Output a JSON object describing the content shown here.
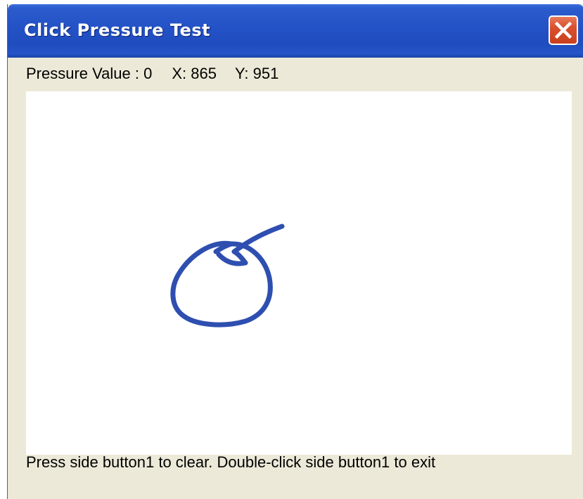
{
  "window": {
    "title": "Click Pressure Test"
  },
  "close_icon": "close-icon",
  "readout": {
    "pressure_text": "Pressure Value : 0",
    "x_text": "X: 865",
    "y_text": "Y: 951"
  },
  "drawing": {
    "stroke_color": "#2E4FB0"
  },
  "status": {
    "text": "Press side button1 to clear. Double-click side button1 to exit"
  },
  "colors": {
    "titlebar": "#2453C8",
    "window_bg": "#ECE9D8",
    "close_button": "#D9502E"
  }
}
